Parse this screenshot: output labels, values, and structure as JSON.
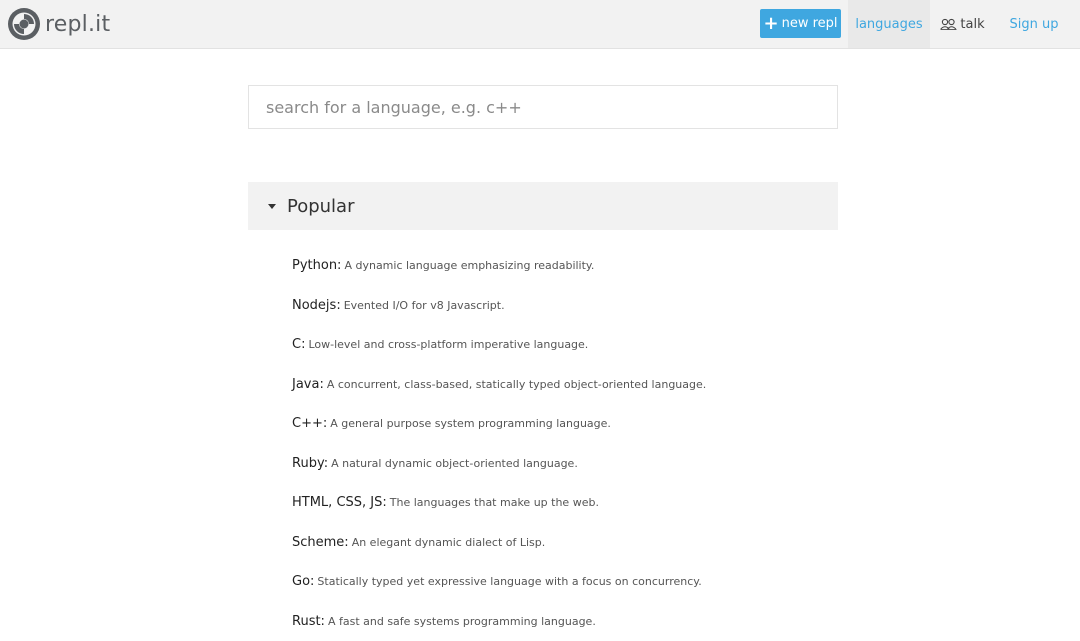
{
  "header": {
    "logo_text": "repl.it",
    "new_repl_label": "new repl",
    "languages_label": "languages",
    "talk_label": "talk",
    "signup_label": "Sign up",
    "accent_color": "#3fa7e0"
  },
  "search": {
    "placeholder": "search for a language, e.g. c++"
  },
  "section": {
    "title": "Popular",
    "icon": "caret-down-icon"
  },
  "languages": [
    {
      "name": "Python:",
      "desc": "A dynamic language emphasizing readability."
    },
    {
      "name": "Nodejs:",
      "desc": "Evented I/O for v8 Javascript."
    },
    {
      "name": "C:",
      "desc": "Low-level and cross-platform imperative language."
    },
    {
      "name": "Java:",
      "desc": "A concurrent, class-based, statically typed object-oriented language."
    },
    {
      "name": "C++:",
      "desc": "A general purpose system programming language."
    },
    {
      "name": "Ruby:",
      "desc": "A natural dynamic object-oriented language."
    },
    {
      "name": "HTML, CSS, JS:",
      "desc": "The languages that make up the web."
    },
    {
      "name": "Scheme:",
      "desc": "An elegant dynamic dialect of Lisp."
    },
    {
      "name": "Go:",
      "desc": "Statically typed yet expressive language with a focus on concurrency."
    },
    {
      "name": "Rust:",
      "desc": "A fast and safe systems programming language."
    }
  ]
}
